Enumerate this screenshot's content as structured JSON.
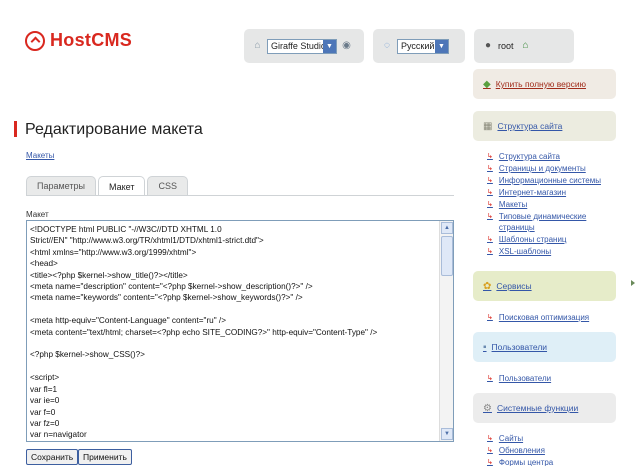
{
  "brand": {
    "logo_text": "HostCMS",
    "accent_color": "#d9281f"
  },
  "topbar": {
    "site_icon": "building-icon",
    "site_select": "Giraffe Studio",
    "eye_icon": "eye-icon",
    "lang_icon": "chat-bubble-icon",
    "lang_select": "Русский",
    "user_icon": "user-icon",
    "user_name": "root",
    "home_icon": "home-icon"
  },
  "main": {
    "title": "Редактирование макета",
    "breadcrumb": "Макеты",
    "tabs": [
      {
        "label": "Параметры",
        "active": false
      },
      {
        "label": "Макет",
        "active": true
      },
      {
        "label": "CSS",
        "active": false
      }
    ],
    "editor_label": "Макет",
    "code": "<!DOCTYPE html PUBLIC \"-//W3C//DTD XHTML 1.0\nStrict//EN\" \"http://www.w3.org/TR/xhtml1/DTD/xhtml1-strict.dtd\">\n<html xmlns=\"http://www.w3.org/1999/xhtml\">\n<head>\n<title><?php $kernel->show_title()?></title>\n<meta name=\"description\" content=\"<?php $kernel->show_description()?>\" />\n<meta name=\"keywords\" content=\"<?php $kernel->show_keywords()?>\" />\n\n<meta http-equiv=\"Content-Language\" content=\"ru\" />\n<meta content=\"text/html; charset=<?php echo SITE_CODING?>\" http-equiv=\"Content-Type\" />\n\n<?php $kernel->show_CSS()?>\n\n<script>\nvar fl=1\nvar ie=0\nvar f=0\nvar fz=0\nvar n=navigator",
    "buttons": {
      "save": "Сохранить",
      "apply": "Применить"
    }
  },
  "sidebar": {
    "buy_full": "Купить полную версию",
    "structure": {
      "header": "Структура сайта",
      "items": [
        "Структура сайта",
        "Страницы и документы",
        "Информационные системы",
        "Интернет-магазин",
        "Макеты",
        "Типовые динамические страницы",
        "Шаблоны страниц",
        "XSL-шаблоны"
      ]
    },
    "services": {
      "header": "Сервисы",
      "items": [
        "Поисковая оптимизация"
      ]
    },
    "users": {
      "header": "Пользователи",
      "items": [
        "Пользователи"
      ]
    },
    "system": {
      "header": "Системные функции",
      "items": [
        "Сайты",
        "Обновления",
        "Формы центра"
      ]
    }
  }
}
